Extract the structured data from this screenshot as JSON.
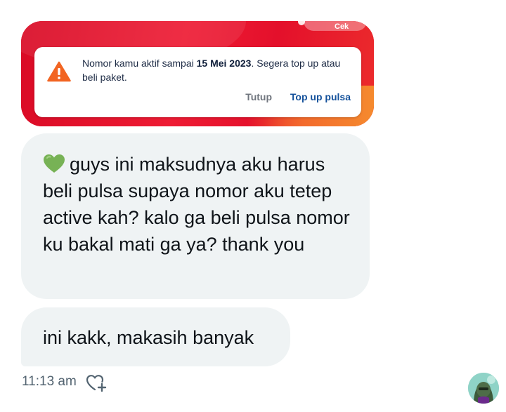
{
  "notification": {
    "top_button_label": "Cek",
    "message_prefix": "Nomor kamu aktif sampai ",
    "message_date": "15 Mei 2023",
    "message_suffix": ". Segera top up atau beli paket.",
    "close_label": "Tutup",
    "action_label": "Top up pulsa",
    "warning_icon": "warning-triangle-icon",
    "colors": {
      "banner": "#e8112d",
      "warning": "#f26522",
      "action": "#14519b"
    }
  },
  "messages": [
    {
      "emoji": "green-heart-icon",
      "text": "guys ini maksudnya aku harus beli pulsa supaya nomor aku tetep active kah? kalo ga beli pulsa nomor ku bakal mati ga ya? thank you"
    },
    {
      "text": "ini kakk, makasih banyak"
    }
  ],
  "meta": {
    "timestamp": "11:13 am",
    "react_icon": "add-reaction-heart-icon"
  },
  "colors": {
    "bubble": "#eff3f4",
    "text": "#0f1419",
    "muted": "#536471"
  }
}
